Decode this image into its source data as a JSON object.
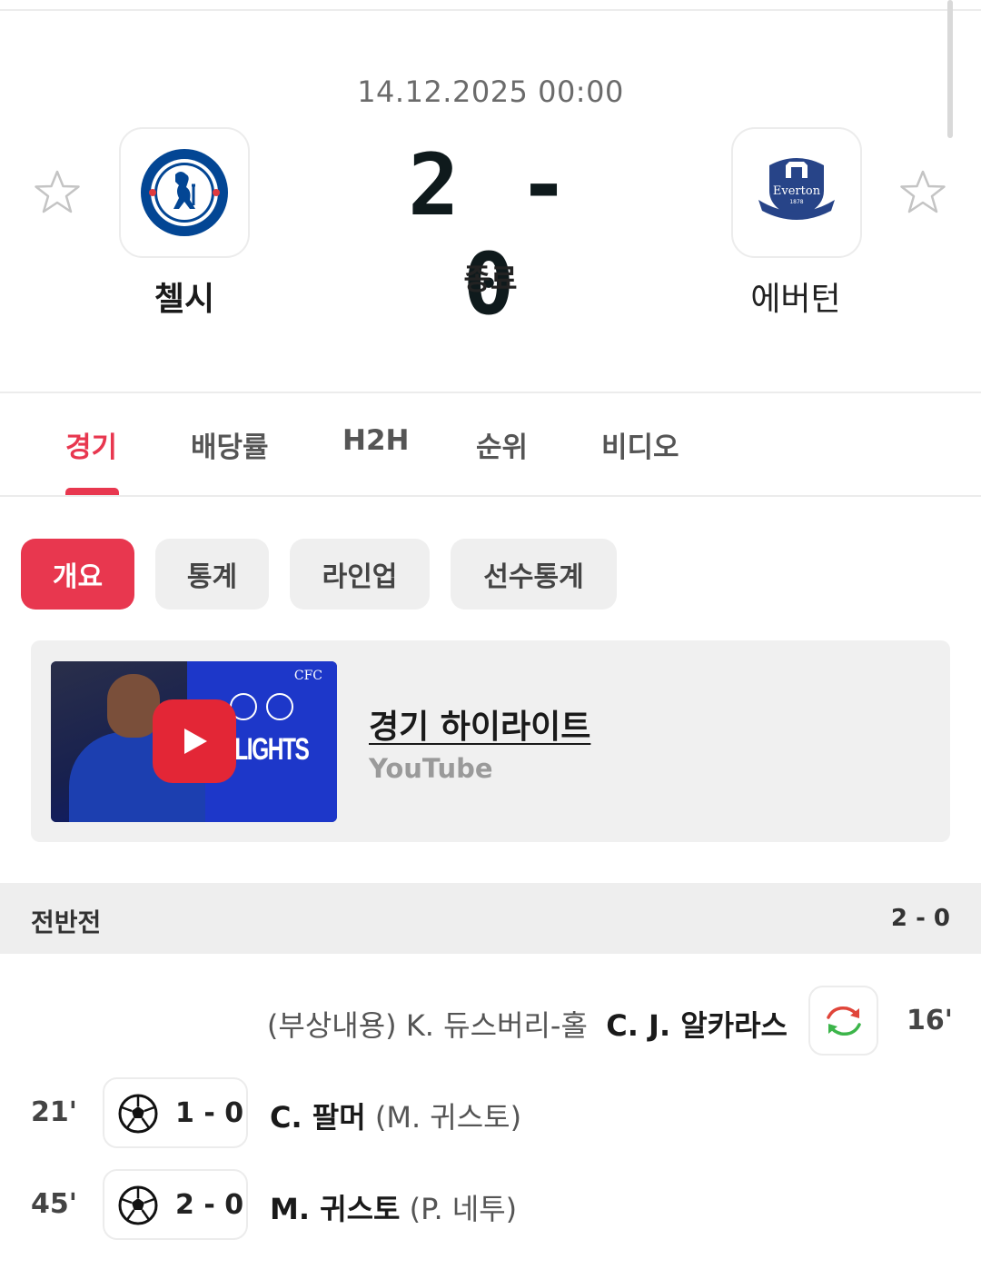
{
  "match": {
    "datetime": "14.12.2025 00:00",
    "score": "2 - 0",
    "status": "종료",
    "home_team": "첼시",
    "away_team": "에버턴",
    "home_crest_text": "CHELSEA FOOTBALL CLUB",
    "away_crest_text": "Everton 1878 NIL SATIS NISI OPTIMUM"
  },
  "tabs": [
    {
      "label": "경기",
      "active": true
    },
    {
      "label": "배당률",
      "active": false
    },
    {
      "label": "H2H",
      "active": false
    },
    {
      "label": "순위",
      "active": false
    },
    {
      "label": "비디오",
      "active": false
    }
  ],
  "chips": [
    {
      "label": "개요",
      "active": true
    },
    {
      "label": "통계",
      "active": false
    },
    {
      "label": "라인업",
      "active": false
    },
    {
      "label": "선수통계",
      "active": false
    }
  ],
  "video": {
    "title": "경기 하이라이트",
    "source": "YouTube",
    "thumb_brand": "CFC",
    "thumb_text": "HLIGHTS"
  },
  "first_half": {
    "label": "전반전",
    "score": "2 - 0"
  },
  "events": [
    {
      "type": "substitution",
      "minute": "16'",
      "player_in": "C. J. 알카라스",
      "detail": "(부상내용) K. 듀스버리-홀"
    },
    {
      "type": "goal",
      "minute": "21'",
      "score": "1 - 0",
      "scorer": "C. 팔머",
      "assist": "(M. 귀스토)"
    },
    {
      "type": "goal",
      "minute": "45'",
      "score": "2 - 0",
      "scorer": "M. 귀스토",
      "assist": "(P. 네투)"
    }
  ],
  "colors": {
    "accent": "#e8374f",
    "chelsea_blue": "#034694",
    "everton_blue": "#274488"
  },
  "icons": [
    "star-icon",
    "play-icon",
    "substitution-icon",
    "soccer-ball-icon"
  ]
}
